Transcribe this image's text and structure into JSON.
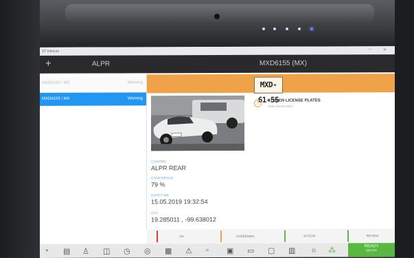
{
  "window": {
    "title": "ST Infinium",
    "controls": [
      "—",
      "✕"
    ]
  },
  "header": {
    "add_icon": "plus-icon",
    "app_title": "ALPR",
    "plate_title": "MXD6155 (MX)"
  },
  "list": {
    "items": [
      {
        "plate": "MXD6155 / MX",
        "status": "Warning"
      },
      {
        "plate": "MXD6155 / MX",
        "status": "Warning"
      }
    ]
  },
  "detail": {
    "plate_read": "MXD-61-55",
    "alert": {
      "title": "STOLEN LICENSE PLATES",
      "subtitle": "Stolen license plates"
    },
    "fields": [
      {
        "label": "CHANNEL",
        "value": "ALPR REAR"
      },
      {
        "label": "CONFIDENCE",
        "value": "79 %"
      },
      {
        "label": "DATE/TIME",
        "value": "15.05.2019 19:32:54"
      },
      {
        "label": "GPS",
        "value": "19.285011 , -99.638012"
      }
    ]
  },
  "actions": [
    {
      "label": "OK",
      "color": "#e53935"
    },
    {
      "label": "SCREENING",
      "color": "#f0a248"
    },
    {
      "label": "ACTION",
      "color": "#59b83f"
    },
    {
      "label": "REVIEW",
      "color": "#59b83f"
    }
  ],
  "taskbar": {
    "icons": [
      "speedometer-icon",
      "document-icon",
      "people-icon",
      "camera-icon",
      "clock-icon",
      "speed-limit-icon",
      "list-icon",
      "warning-icon",
      "blank-icon",
      "clipboard-icon",
      "id-card-icon",
      "monitor-icon",
      "grid-icon",
      "brightness-icon",
      "status-dots-icon"
    ],
    "ready_label": "READY",
    "ready_sub": "SENTRY"
  },
  "colors": {
    "accent": "#2196f3",
    "warning": "#f0a248",
    "ready": "#59b83f",
    "header": "#2a2a2d"
  }
}
